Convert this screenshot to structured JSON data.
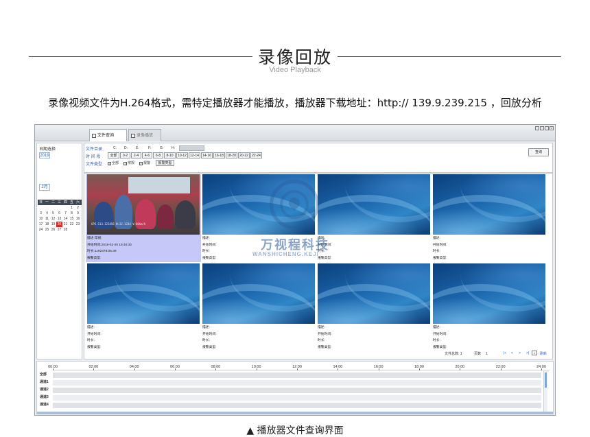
{
  "header": {
    "title": "录像回放",
    "subtitle": "Video Playback",
    "description": "录像视频文件为H.264格式，需特定播放器才能播放，播放器下载地址：http:// 139.9.239.215 ，回放分析"
  },
  "app": {
    "tabs": [
      {
        "label": "文件查询",
        "active": true
      },
      {
        "label": "录像播放",
        "active": false
      }
    ],
    "left_panel": {
      "date_label": "日期选择",
      "year": "2019",
      "month": "2月",
      "weekdays": [
        "日",
        "一",
        "二",
        "三",
        "四",
        "五",
        "六"
      ],
      "days": [
        "",
        "",
        "",
        "",
        "",
        "1",
        "2",
        "3",
        "4",
        "5",
        "6",
        "7",
        "8",
        "9",
        "10",
        "11",
        "12",
        "13",
        "14",
        "15",
        "16",
        "17",
        "18",
        "19",
        "20",
        "21",
        "22",
        "23",
        "24",
        "25",
        "26",
        "27",
        "28"
      ],
      "selected_day": "20"
    },
    "filter": {
      "directory_label": "文件目录",
      "time_label": "时 间 段",
      "type_label": "文件类型",
      "drives": [
        "C:",
        "D:",
        "E:",
        "F:",
        "G:",
        "H:"
      ],
      "time_buttons": [
        "全部",
        "0-2",
        "2-4",
        "4-6",
        "6-8",
        "8-10",
        "10-12",
        "12-14",
        "14-16",
        "16-18",
        "18-20",
        "20-22",
        "22-24"
      ],
      "types": [
        {
          "label": "全部",
          "checked": true
        },
        {
          "label": "常规",
          "checked": true
        },
        {
          "label": "报警",
          "checked": true
        }
      ],
      "alarm_type_button": "报警类型",
      "query_button": "查询"
    },
    "files": [
      {
        "desc": "描述:常规",
        "start": "开始时间:2019-02-20 16:49:32",
        "duration": "时长:1192478:05:49",
        "alarm": "报警类型:",
        "live": true
      },
      {
        "desc": "描述:",
        "start": "开始时间:",
        "duration": "时长:",
        "alarm": "报警类型:",
        "live": false
      },
      {
        "desc": "描述:",
        "start": "开始时间:",
        "duration": "时长:",
        "alarm": "报警类型:",
        "live": false
      },
      {
        "desc": "描述:",
        "start": "开始时间:",
        "duration": "时长:",
        "alarm": "报警类型:",
        "live": false
      },
      {
        "desc": "描述:",
        "start": "开始时间:",
        "duration": "时长:",
        "alarm": "报警类型:",
        "live": false
      },
      {
        "desc": "描述:",
        "start": "开始时间:",
        "duration": "时长:",
        "alarm": "报警类型:",
        "live": false
      },
      {
        "desc": "描述:",
        "start": "开始时间:",
        "duration": "时长:",
        "alarm": "报警类型:",
        "live": false
      },
      {
        "desc": "描述:",
        "start": "开始时间:",
        "duration": "时长:",
        "alarm": "报警类型:",
        "live": false
      }
    ],
    "live_osd": "GPS:113.123456 N:22.1234 V:60km/h",
    "pager": {
      "file_count_label": "文件总数:",
      "file_count": "1",
      "page_label": "页数",
      "page_count": "1",
      "first": "|<",
      "prev": "<",
      "next": ">",
      "last": ">|",
      "page_input": "1",
      "refresh": "刷新"
    },
    "timeline": {
      "ticks": [
        "00:00",
        "02:00",
        "04:00",
        "06:00",
        "08:00",
        "10:00",
        "12:00",
        "14:00",
        "16:00",
        "18:00",
        "20:00",
        "22:00",
        "24:00"
      ],
      "rows": [
        "全部",
        "通道1",
        "通道2",
        "通道3",
        "通道4"
      ]
    }
  },
  "watermark": {
    "cn": "万视程科技",
    "en": "WANSHICHENG.KEJI"
  },
  "caption": "▲ 播放器文件查询界面"
}
